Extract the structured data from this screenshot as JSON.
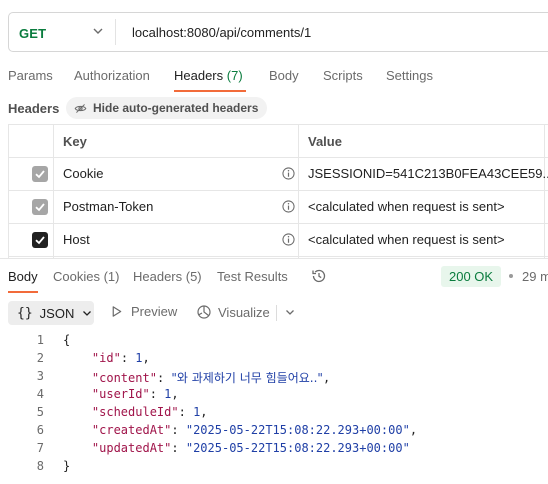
{
  "request": {
    "method": "GET",
    "url": "localhost:8080/api/comments/1"
  },
  "request_tabs": [
    {
      "label": "Params"
    },
    {
      "label": "Authorization"
    },
    {
      "label": "Headers",
      "count": "(7)"
    },
    {
      "label": "Body"
    },
    {
      "label": "Scripts"
    },
    {
      "label": "Settings"
    }
  ],
  "headers_section": {
    "label": "Headers",
    "hide_button": "Hide auto-generated headers",
    "columns": {
      "key": "Key",
      "value": "Value"
    },
    "rows": [
      {
        "key": "Cookie",
        "value": "JSESSIONID=541C213B0FEA43CEE59...",
        "checked_style": "grey"
      },
      {
        "key": "Postman-Token",
        "value": "<calculated when request is sent>",
        "checked_style": "grey"
      },
      {
        "key": "Host",
        "value": "<calculated when request is sent>",
        "checked_style": "black"
      }
    ]
  },
  "response_tabs": [
    {
      "label": "Body"
    },
    {
      "label": "Cookies (1)"
    },
    {
      "label": "Headers (5)"
    },
    {
      "label": "Test Results"
    }
  ],
  "response_status": {
    "status": "200 OK",
    "time": "29 m"
  },
  "format_toolbar": {
    "braces": "{}",
    "format": "JSON",
    "preview": "Preview",
    "visualize": "Visualize"
  },
  "code_lines": [
    {
      "n": "1"
    },
    {
      "n": "2"
    },
    {
      "n": "3"
    },
    {
      "n": "4"
    },
    {
      "n": "5"
    },
    {
      "n": "6"
    },
    {
      "n": "7"
    },
    {
      "n": "8"
    }
  ],
  "response_body": {
    "open": "{",
    "close": "}",
    "fields": [
      {
        "key": "\"id\"",
        "value": "1",
        "type": "number",
        "comma": ","
      },
      {
        "key": "\"content\"",
        "value": "\"와 과제하기 너무 힘들어요..\"",
        "type": "string",
        "comma": ","
      },
      {
        "key": "\"userId\"",
        "value": "1",
        "type": "number",
        "comma": ","
      },
      {
        "key": "\"scheduleId\"",
        "value": "1",
        "type": "number",
        "comma": ","
      },
      {
        "key": "\"createdAt\"",
        "value": "\"2025-05-22T15:08:22.293+00:00\"",
        "type": "string",
        "comma": ","
      },
      {
        "key": "\"updatedAt\"",
        "value": "\"2025-05-22T15:08:22.293+00:00\"",
        "type": "string",
        "comma": ""
      }
    ]
  },
  "colors": {
    "accent_orange": "#f26b3a",
    "method_green": "#0a7c3e",
    "json_key": "#a0144a",
    "json_value": "#1f3fa6"
  },
  "icons": {
    "method_dropdown": "chevron-down-icon",
    "info": "info-icon",
    "hide_headers": "eye-slash-icon",
    "history": "history-icon",
    "preview": "play-icon",
    "visualize": "visualize-icon",
    "checkbox": "checkmark-icon"
  }
}
